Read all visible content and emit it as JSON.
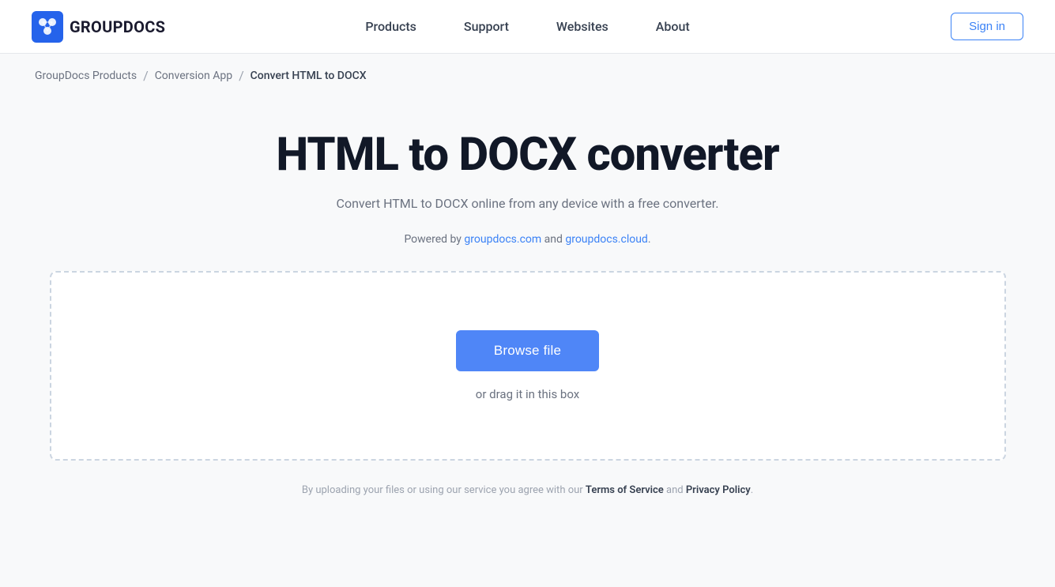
{
  "logo": {
    "text": "GROUPDOCS"
  },
  "nav": {
    "items": [
      {
        "label": "Products",
        "href": "#"
      },
      {
        "label": "Support",
        "href": "#"
      },
      {
        "label": "Websites",
        "href": "#"
      },
      {
        "label": "About",
        "href": "#"
      }
    ],
    "sign_in_label": "Sign in"
  },
  "breadcrumb": {
    "items": [
      {
        "label": "GroupDocs Products",
        "href": "#"
      },
      {
        "label": "Conversion App",
        "href": "#"
      },
      {
        "label": "Convert HTML to DOCX"
      }
    ]
  },
  "main": {
    "title": "HTML to DOCX converter",
    "subtitle": "Convert HTML to DOCX online from any device with a free converter.",
    "powered_by_prefix": "Powered by ",
    "powered_by_link1_text": "groupdocs.com",
    "powered_by_link1_href": "#",
    "powered_by_middle": " and ",
    "powered_by_link2_text": "groupdocs.cloud",
    "powered_by_link2_href": "#",
    "powered_by_suffix": ".",
    "browse_file_label": "Browse file",
    "drag_text": "or drag it in this box",
    "disclaimer_prefix": "By uploading your files or using our service you agree with our ",
    "tos_label": "Terms of Service",
    "tos_href": "#",
    "disclaimer_and": " and ",
    "privacy_label": "Privacy Policy",
    "privacy_href": "#",
    "disclaimer_suffix": "."
  }
}
